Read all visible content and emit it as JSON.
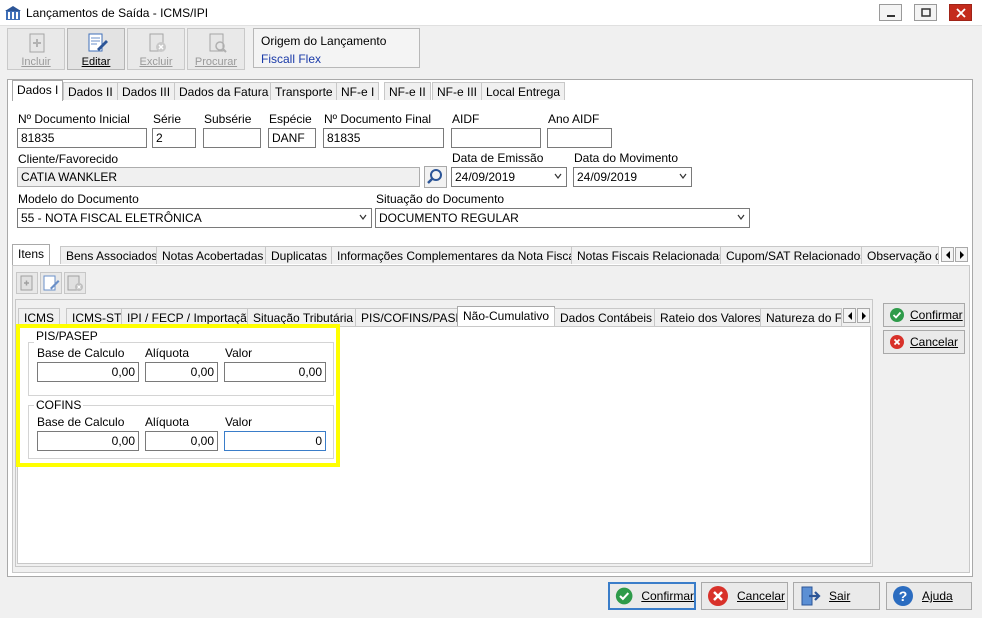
{
  "window": {
    "title": "Lançamentos de Saída - ICMS/IPI"
  },
  "toolbar": {
    "incluir": "Incluir",
    "editar": "Editar",
    "excluir": "Excluir",
    "procurar": "Procurar"
  },
  "origem": {
    "label": "Origem do Lançamento",
    "value": "Fiscall Flex"
  },
  "top_tabs": [
    "Dados I",
    "Dados II",
    "Dados III",
    "Dados da Fatura",
    "Transporte",
    "NF-e I",
    "NF-e II",
    "NF-e III",
    "Local Entrega"
  ],
  "form": {
    "doc_inicial_label": "Nº Documento Inicial",
    "doc_inicial_value": "81835",
    "serie_label": "Série",
    "serie_value": "2",
    "subserie_label": "Subsérie",
    "subserie_value": "",
    "especie_label": "Espécie",
    "especie_value": "DANF",
    "doc_final_label": "Nº Documento Final",
    "doc_final_value": "81835",
    "aidf_label": "AIDF",
    "aidf_value": "",
    "ano_aidf_label": "Ano AIDF",
    "ano_aidf_value": "",
    "cliente_label": "Cliente/Favorecido",
    "cliente_value": "CATIA WANKLER",
    "data_emissao_label": "Data de Emissão",
    "data_emissao_value": "24/09/2019",
    "data_movimento_label": "Data do Movimento",
    "data_movimento_value": "24/09/2019",
    "modelo_label": "Modelo do Documento",
    "modelo_value": "55 - NOTA FISCAL ELETRÔNICA",
    "situacao_label": "Situação do Documento",
    "situacao_value": "DOCUMENTO REGULAR"
  },
  "item_tabs": [
    "Itens",
    "Bens Associados",
    "Notas Acobertadas",
    "Duplicatas",
    "Informações Complementares da Nota Fiscal",
    "Notas Fiscais Relacionadas",
    "Cupom/SAT Relacionados",
    "Observação do"
  ],
  "tax_tabs": [
    "ICMS",
    "ICMS-ST",
    "IPI / FECP / Importação",
    "Situação Tributária",
    "PIS/COFINS/PASEP",
    "Não-Cumulativo",
    "Dados Contábeis",
    "Rateio dos Valores",
    "Natureza do Fr"
  ],
  "pis": {
    "title": "PIS/PASEP",
    "base_label": "Base de Calculo",
    "base_value": "0,00",
    "aliquota_label": "Alíquota",
    "aliquota_value": "0,00",
    "valor_label": "Valor",
    "valor_value": "0,00"
  },
  "cofins": {
    "title": "COFINS",
    "base_label": "Base de Calculo",
    "base_value": "0,00",
    "aliquota_label": "Alíquota",
    "aliquota_value": "0,00",
    "valor_label": "Valor",
    "valor_value": "0"
  },
  "side_buttons": {
    "confirmar": "Confirmar",
    "cancelar": "Cancelar"
  },
  "bottom_buttons": {
    "confirmar": "Confirmar",
    "cancelar": "Cancelar",
    "sair": "Sair",
    "ajuda": "Ajuda"
  },
  "colors": {
    "highlight": "#ffff00",
    "link_blue": "#1a3aa8",
    "confirm_green": "#2e9b4a",
    "cancel_red": "#d8312a",
    "help_blue": "#2b6cc0"
  }
}
